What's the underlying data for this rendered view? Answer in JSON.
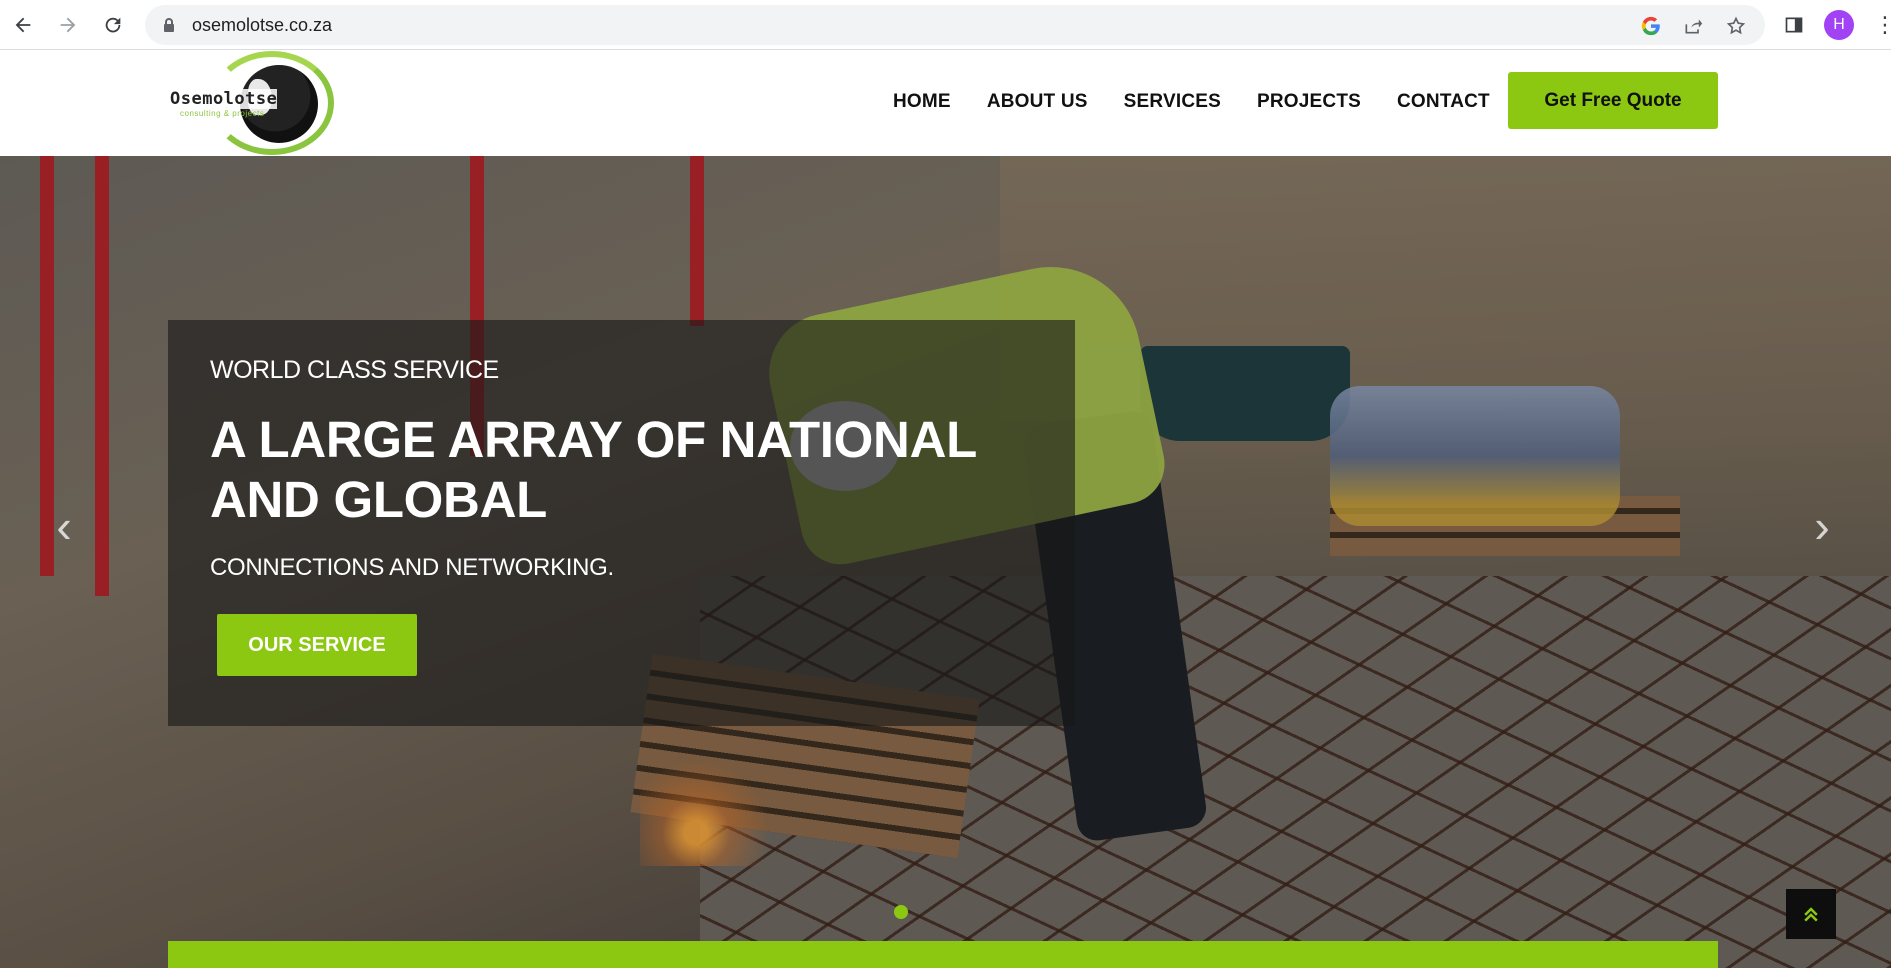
{
  "browser": {
    "url": "osemolotse.co.za",
    "profile_initial": "H"
  },
  "site": {
    "logo_text": "Osemolotse",
    "logo_subtext": "consulting & projects",
    "nav": [
      {
        "label": "HOME"
      },
      {
        "label": "ABOUT US"
      },
      {
        "label": "SERVICES"
      },
      {
        "label": "PROJECTS"
      },
      {
        "label": "CONTACT"
      }
    ],
    "quote_button": "Get Free Quote"
  },
  "hero": {
    "kicker": "WORLD CLASS SERVICE",
    "title": "A LARGE ARRAY OF NATIONAL AND GLOBAL",
    "subtitle": "CONNECTIONS AND NETWORKING.",
    "button": "OUR SERVICE",
    "prev_glyph": "‹",
    "next_glyph": "›",
    "scroll_top_glyph": "⌃"
  },
  "colors": {
    "accent": "#8cc812",
    "overlay": "rgba(25,25,25,0.62)"
  },
  "icons": {
    "back": "back-arrow-icon",
    "forward": "forward-arrow-icon",
    "reload": "reload-icon",
    "lock": "lock-icon",
    "google": "google-icon",
    "share": "share-icon",
    "star": "bookmark-star-icon",
    "sidepanel": "side-panel-icon",
    "menu": "kebab-menu-icon"
  }
}
